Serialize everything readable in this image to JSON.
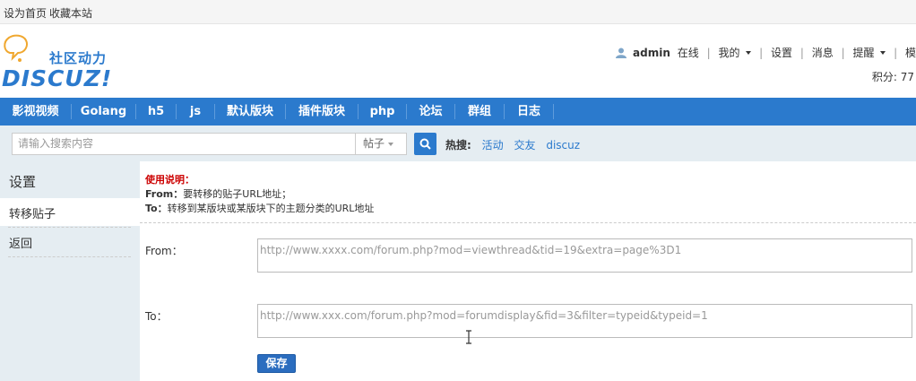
{
  "topbar": {
    "set_home": "设为首页",
    "bookmark": "收藏本站"
  },
  "logo": {
    "text_cn": "社区动力",
    "text_en": "DISCUZ!"
  },
  "userbar": {
    "username": "admin",
    "status": "在线",
    "my": "我的",
    "settings": "设置",
    "messages": "消息",
    "reminders": "提醒",
    "more": "模",
    "credits": "积分: 77"
  },
  "nav": {
    "items": [
      "影视视频",
      "Golang",
      "h5",
      "js",
      "默认版块",
      "插件版块",
      "php",
      "论坛",
      "群组",
      "日志"
    ]
  },
  "search": {
    "placeholder": "请输入搜索内容",
    "type": "帖子",
    "hot_label": "热搜:",
    "hot_links": [
      "活动",
      "交友",
      "discuz"
    ]
  },
  "sidebar": {
    "title": "设置",
    "items": [
      "转移贴子",
      "返回"
    ]
  },
  "content": {
    "notes_title": "使用说明：",
    "from_label_bold": "From：",
    "from_desc": "要转移的贴子URL地址；",
    "to_label_bold": "To：",
    "to_desc": "转移到某版块或某版块下的主题分类的URL地址",
    "from_label": "From：",
    "from_placeholder": "http://www.xxxx.com/forum.php?mod=viewthread&tid=19&extra=page%3D1",
    "to_label": "To：",
    "to_placeholder": "http://www.xxx.com/forum.php?mod=forumdisplay&fid=3&filter=typeid&typeid=1",
    "save": "保存"
  },
  "colors": {
    "nav_bg": "#2b7acd",
    "panel_bg": "#e5edf2",
    "note_red": "#cc0000"
  }
}
